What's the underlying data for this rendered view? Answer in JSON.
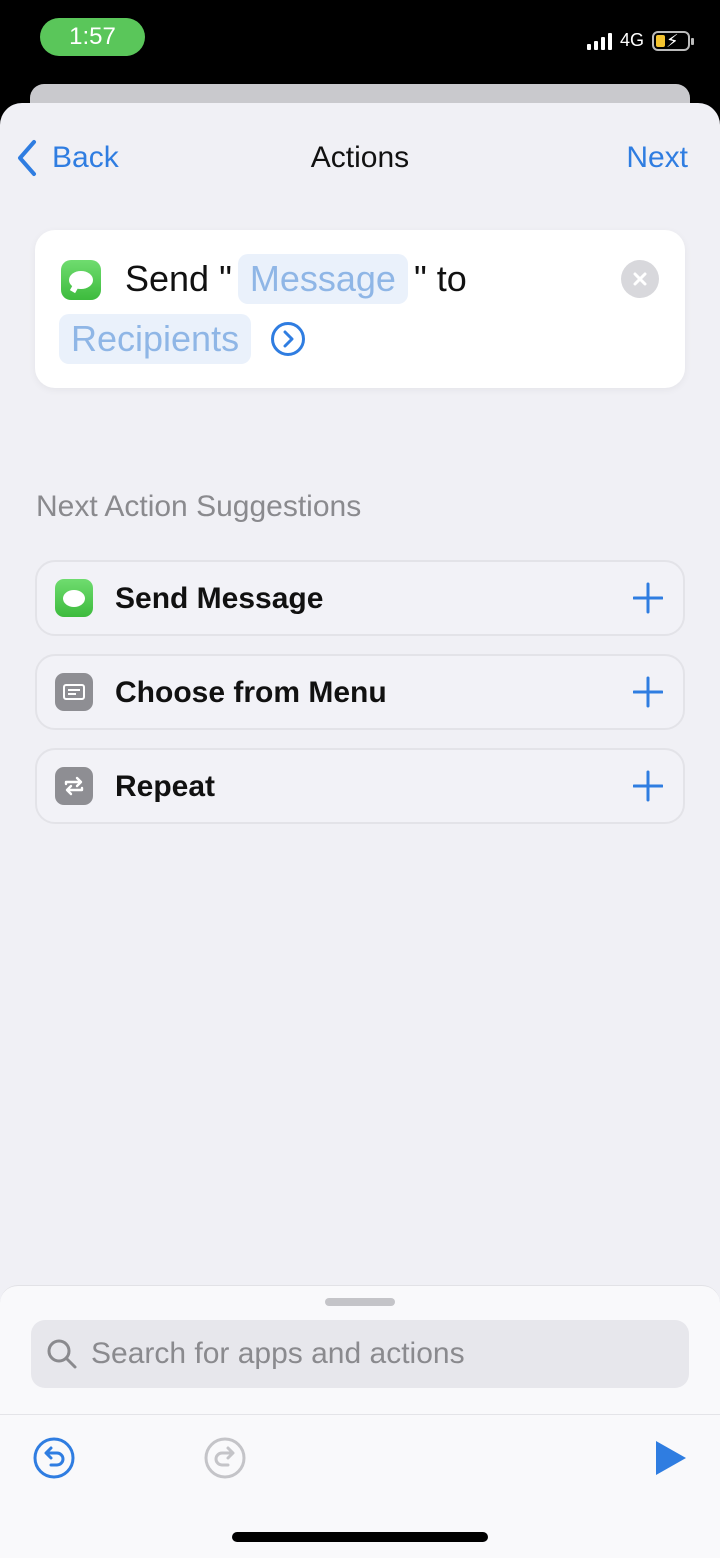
{
  "status_bar": {
    "time": "1:57",
    "network": "4G"
  },
  "nav": {
    "back_label": "Back",
    "title": "Actions",
    "next_label": "Next"
  },
  "action_card": {
    "text_send": "Send \"",
    "message_token": "Message",
    "text_to": "\" to",
    "recipients_token": "Recipients"
  },
  "suggestions": {
    "title": "Next Action Suggestions",
    "items": [
      {
        "label": "Send Message",
        "icon": "messages-icon"
      },
      {
        "label": "Choose from Menu",
        "icon": "menu-icon"
      },
      {
        "label": "Repeat",
        "icon": "repeat-icon"
      }
    ]
  },
  "search": {
    "placeholder": "Search for apps and actions",
    "value": ""
  },
  "colors": {
    "accent": "#2f7de1",
    "token_text": "#8fb6e6",
    "token_bg": "#eaf1fb",
    "messages_green": "#4cc94c",
    "status_time_bg": "#5ac65a"
  }
}
